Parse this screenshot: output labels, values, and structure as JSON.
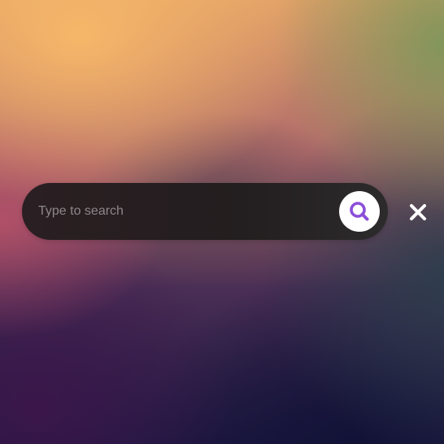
{
  "search": {
    "placeholder": "Type to search",
    "value": ""
  },
  "icons": {
    "search": "search-icon",
    "close": "close-icon"
  },
  "colors": {
    "accent": "#8b4fd8",
    "bar": "#231e1f",
    "close": "#ffffff"
  }
}
